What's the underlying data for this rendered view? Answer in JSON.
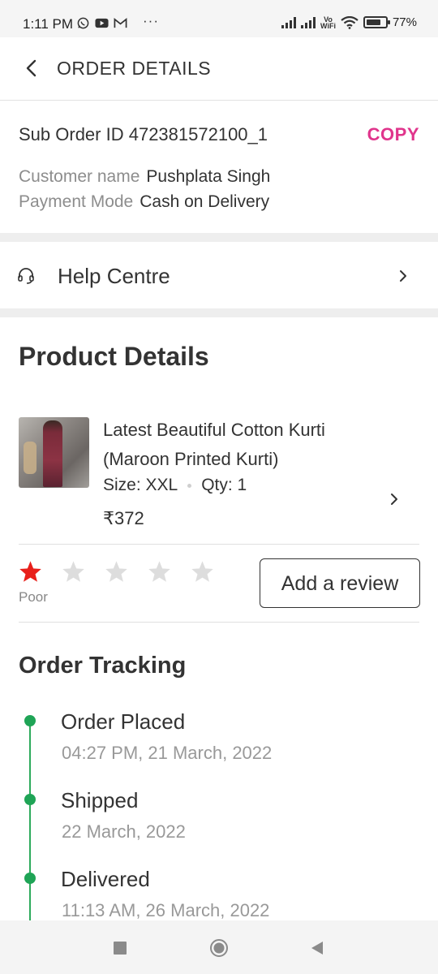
{
  "status_bar": {
    "time": "1:11 PM",
    "icons": [
      "whatsapp-icon",
      "youtube-icon",
      "gmail-icon"
    ],
    "overflow": "···",
    "vowifi_top": "Vo",
    "vowifi_bottom": "WiFi",
    "battery": "77%",
    "battery_level": 0.77
  },
  "header": {
    "title": "ORDER DETAILS"
  },
  "sub_order": {
    "label": "Sub Order ID 472381572100_1",
    "copy_label": "COPY",
    "customer_label": "Customer name",
    "customer_value": "Pushplata Singh",
    "payment_label": "Payment Mode",
    "payment_value": "Cash on Delivery"
  },
  "help": {
    "label": "Help Centre"
  },
  "product_details": {
    "title": "Product Details",
    "name": "Latest Beautiful Cotton Kurti (Maroon Printed Kurti)",
    "size": "Size: XXL",
    "qty": "Qty: 1",
    "price": "₹372"
  },
  "rating": {
    "value": 1,
    "max": 5,
    "label": "Poor",
    "button": "Add a review"
  },
  "tracking": {
    "title": "Order Tracking",
    "steps": [
      {
        "status": "Order Placed",
        "date": "04:27 PM, 21 March, 2022"
      },
      {
        "status": "Shipped",
        "date": "22 March, 2022"
      },
      {
        "status": "Delivered",
        "date": "11:13 AM, 26 March, 2022"
      }
    ]
  },
  "colors": {
    "accent": "#e0358c",
    "tracking_green": "#1fa456",
    "star_filled": "#e8201b",
    "star_empty": "#dddddd"
  }
}
